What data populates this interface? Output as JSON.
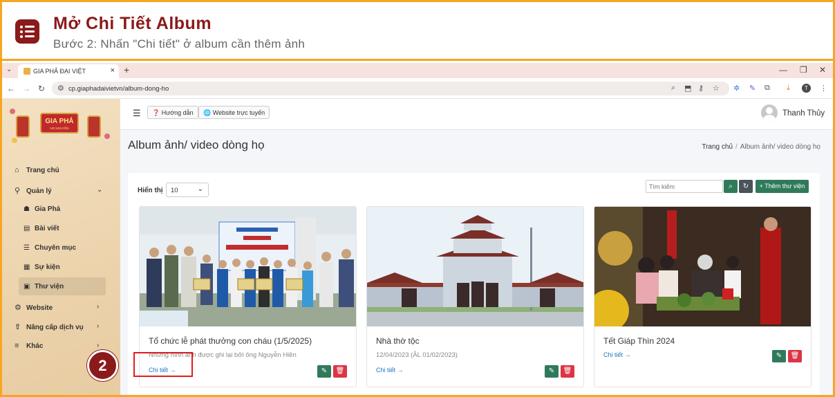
{
  "banner": {
    "title": "Mở Chi Tiết Album",
    "subtitle": "Bước 2: Nhấn \"Chi tiết\" ở album cần thêm ảnh",
    "icon": "list-icon",
    "accent": "#8b1a1a",
    "border_color": "#f5a623"
  },
  "browser": {
    "tab_title": "GIA PHẢ ĐẠI VIỆT",
    "url": "cp.giaphadaivietvn/album-dong-ho",
    "profile_initial": "T"
  },
  "logo": {
    "line1": "GIA PHẢ",
    "line2": "HỌ NGUYỄN"
  },
  "sidebar": {
    "items": [
      {
        "label": "Trang chủ",
        "icon": "home-icon"
      },
      {
        "label": "Quản lý",
        "icon": "sitemap-icon"
      },
      {
        "label": "Website",
        "icon": "gear-icon"
      },
      {
        "label": "Nâng cấp dịch vụ",
        "icon": "upgrade-icon"
      },
      {
        "label": "Khác",
        "icon": "bars-icon"
      }
    ],
    "sub_items": [
      {
        "label": "Gia Phả",
        "icon": "users-icon"
      },
      {
        "label": "Bài viết",
        "icon": "article-icon"
      },
      {
        "label": "Chuyên mục",
        "icon": "list-icon"
      },
      {
        "label": "Sự kiện",
        "icon": "calendar-icon"
      },
      {
        "label": "Thư viện",
        "icon": "images-icon"
      }
    ]
  },
  "topbar": {
    "guide_label": "Hướng dẫn",
    "website_label": "Website trực tuyến",
    "user_name": "Thanh Thủy"
  },
  "page": {
    "title": "Album ảnh/ video dòng họ",
    "breadcrumb_home": "Trang chủ",
    "breadcrumb_sep": "/",
    "breadcrumb_current": "Album ảnh/ video dòng họ"
  },
  "toolbar": {
    "show_label": "Hiển thị",
    "show_value": "10",
    "search_placeholder": "Tìm kiếm",
    "add_label": "Thêm thư viện"
  },
  "albums": [
    {
      "title": "Tổ chức lễ phát thưởng con cháu (1/5/2025)",
      "desc": "Những hình ảnh được ghi lại bởi ông Nguyễn Hiền",
      "link": "Chi tiết →"
    },
    {
      "title": "Nhà thờ tộc",
      "desc": "12/04/2023 (ÂL 01/02/2023)",
      "link": "Chi tiết →"
    },
    {
      "title": "Tết Giáp Thìn 2024",
      "desc": "",
      "link": "Chi tiết →"
    }
  ],
  "annotation": {
    "step": "2",
    "color": "#e21b1b"
  }
}
